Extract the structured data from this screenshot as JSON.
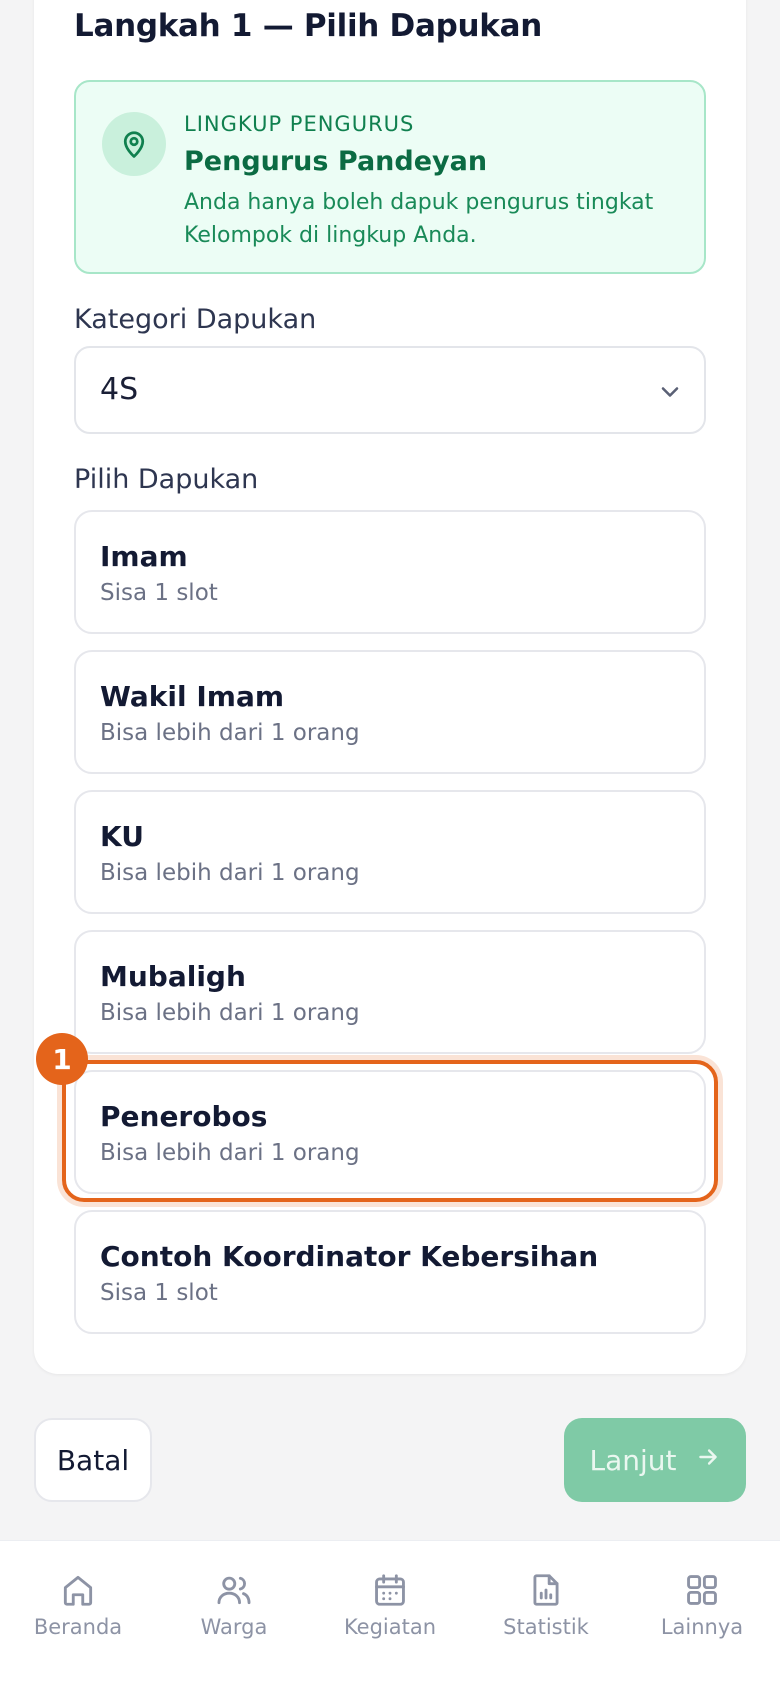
{
  "step_title": "Langkah 1 — Pilih Dapukan",
  "scope": {
    "caption": "LINGKUP PENGURUS",
    "title": "Pengurus Pandeyan",
    "description": "Anda hanya boleh dapuk pengurus tingkat Kelompok di lingkup Anda.",
    "icon": "map-pin-icon"
  },
  "category": {
    "label": "Kategori Dapukan",
    "value": "4S"
  },
  "positions": {
    "label": "Pilih Dapukan",
    "items": [
      {
        "name": "Imam",
        "note": "Sisa 1 slot"
      },
      {
        "name": "Wakil Imam",
        "note": "Bisa lebih dari 1 orang"
      },
      {
        "name": "KU",
        "note": "Bisa lebih dari 1 orang"
      },
      {
        "name": "Mubaligh",
        "note": "Bisa lebih dari 1 orang"
      },
      {
        "name": "Penerobos",
        "note": "Bisa lebih dari 1 orang"
      },
      {
        "name": "Contoh Koordinator Kebersihan",
        "note": "Sisa 1 slot"
      }
    ]
  },
  "annotation_badge": "1",
  "actions": {
    "cancel": "Batal",
    "next": "Lanjut"
  },
  "nav": [
    {
      "label": "Beranda",
      "icon": "home-icon"
    },
    {
      "label": "Warga",
      "icon": "users-icon"
    },
    {
      "label": "Kegiatan",
      "icon": "calendar-icon"
    },
    {
      "label": "Statistik",
      "icon": "report-chart-icon"
    },
    {
      "label": "Lainnya",
      "icon": "grid-icon"
    }
  ],
  "colors": {
    "accent_green": "#10804f",
    "highlight_orange": "#e4641b",
    "next_button": "#7fcaa6"
  }
}
